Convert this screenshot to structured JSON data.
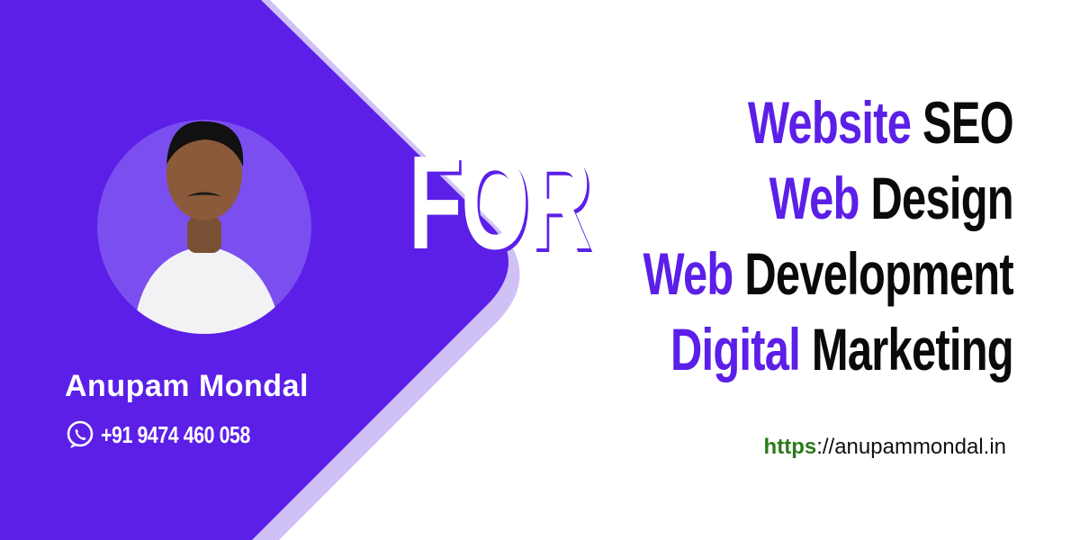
{
  "profile": {
    "name": "Anupam Mondal",
    "phone": "+91 9474 460 058"
  },
  "connector_word": "FOR",
  "services": [
    {
      "accent": "Website",
      "rest": "SEO"
    },
    {
      "accent": "Web",
      "rest": "Design"
    },
    {
      "accent": "Web",
      "rest": "Development"
    },
    {
      "accent": "Digital",
      "rest": "Marketing"
    }
  ],
  "website": {
    "scheme": "https",
    "rest": "://anupammondal.in"
  },
  "colors": {
    "primary_purple": "#5b1fe8",
    "light_lavender": "#cfc0f5",
    "circle_purple": "#7b4ef0",
    "text_dark": "#0a0a0a",
    "url_green": "#2a7a1a",
    "background": "#ffffff"
  },
  "icons": {
    "phone": "whatsapp-icon"
  }
}
